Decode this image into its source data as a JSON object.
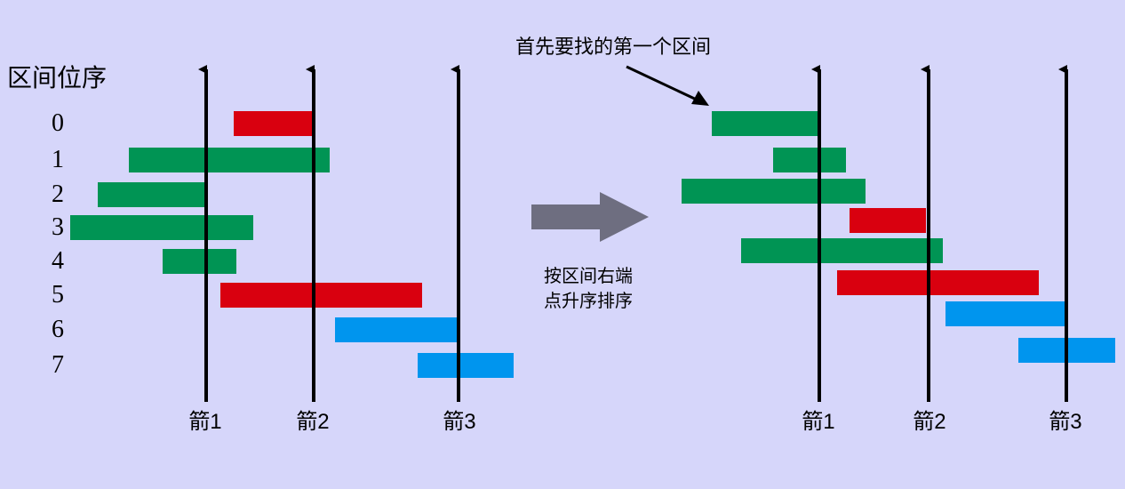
{
  "left_panel": {
    "header": "区间位序",
    "row_labels": [
      "0",
      "1",
      "2",
      "3",
      "4",
      "5",
      "6",
      "7"
    ],
    "intervals": [
      {
        "color": "red"
      },
      {
        "color": "green"
      },
      {
        "color": "green"
      },
      {
        "color": "green"
      },
      {
        "color": "green"
      },
      {
        "color": "red"
      },
      {
        "color": "blue"
      },
      {
        "color": "blue"
      }
    ],
    "arrows": [
      "箭1",
      "箭2",
      "箭3"
    ]
  },
  "transition": {
    "line1": "按区间右端",
    "line2": "点升序排序"
  },
  "right_panel": {
    "callout": "首先要找的第一个区间",
    "intervals": [
      {
        "color": "green"
      },
      {
        "color": "green"
      },
      {
        "color": "green"
      },
      {
        "color": "red"
      },
      {
        "color": "green"
      },
      {
        "color": "red"
      },
      {
        "color": "blue"
      },
      {
        "color": "blue"
      }
    ],
    "arrows": [
      "箭1",
      "箭2",
      "箭3"
    ]
  },
  "colors": {
    "background": "#d6d6fa",
    "green": "#009454",
    "red": "#d9000f",
    "blue": "#0095ee",
    "arrow": "#000000",
    "transition_arrow": "#6e6e80"
  }
}
